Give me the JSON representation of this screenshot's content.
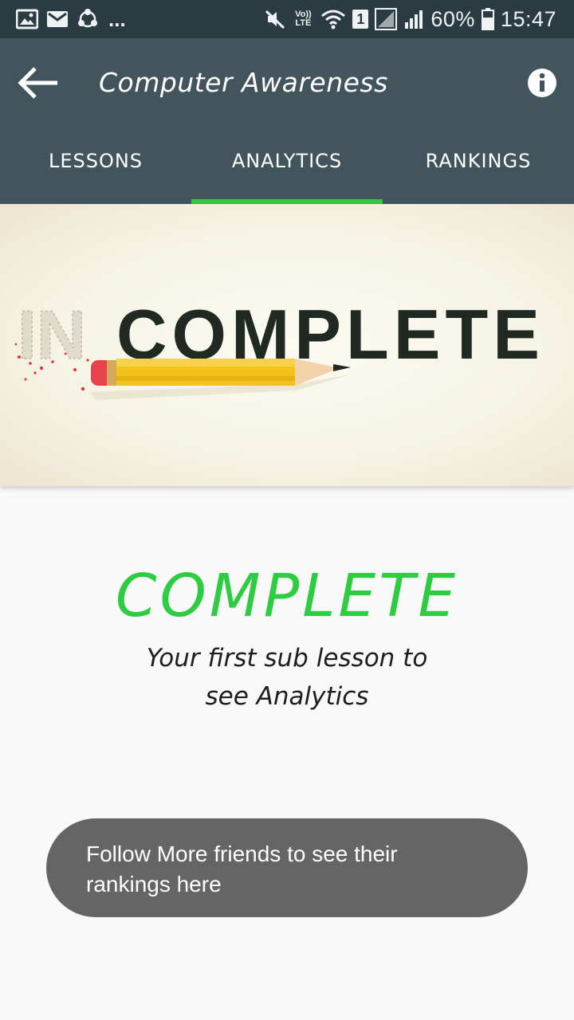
{
  "status_bar": {
    "notification_icons": [
      "image-icon",
      "mail-icon",
      "share-icon"
    ],
    "more": "...",
    "volte_label": "Vo)) LTE",
    "sim_badge": "1",
    "battery": "60%",
    "time": "15:47"
  },
  "app_bar": {
    "title": "Computer Awareness",
    "back_icon": "arrow-left-icon",
    "info_icon": "info-icon"
  },
  "tabs": [
    {
      "label": "LESSONS",
      "selected": false
    },
    {
      "label": "ANALYTICS",
      "selected": true
    },
    {
      "label": "RANKINGS",
      "selected": false
    }
  ],
  "banner": {
    "erased_text": "IN",
    "text": "COMPLETE"
  },
  "message": {
    "title": "COMPLETE",
    "subtitle": "Your first sub lesson to see Analytics"
  },
  "toast": {
    "text": "Follow More friends to see their rankings here"
  },
  "colors": {
    "status_bar": "#2b3b42",
    "app_bar": "#42555d",
    "accent": "#2ecc40",
    "toast": "#656565",
    "background": "#f9f9f9"
  }
}
